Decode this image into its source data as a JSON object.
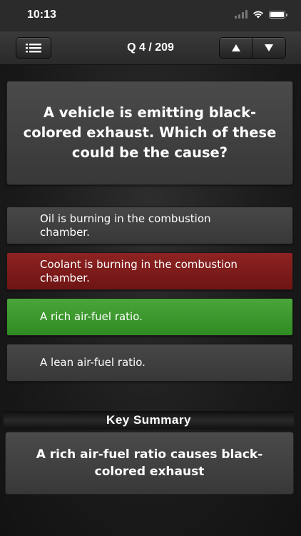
{
  "status_bar": {
    "time": "10:13"
  },
  "toolbar": {
    "counter": "Q 4 / 209",
    "icons": {
      "menu": "list-icon",
      "up": "arrow-up-icon",
      "down": "arrow-down-icon"
    }
  },
  "question": {
    "text": "A vehicle is emitting black-colored exhaust. Which of these could be the cause?"
  },
  "answers": [
    {
      "text": "Oil is burning in the combustion chamber.",
      "state": "neutral"
    },
    {
      "text": "Coolant is burning in the combustion chamber.",
      "state": "wrong"
    },
    {
      "text": "A rich air-fuel ratio.",
      "state": "correct"
    },
    {
      "text": "A lean air-fuel ratio.",
      "state": "neutral"
    }
  ],
  "key_summary": {
    "title": "Key Summary",
    "text": "A rich air-fuel ratio causes black-colored exhaust"
  },
  "colors": {
    "correct": "#3f9a30",
    "wrong": "#7e1b1b",
    "neutral": "#404040"
  }
}
